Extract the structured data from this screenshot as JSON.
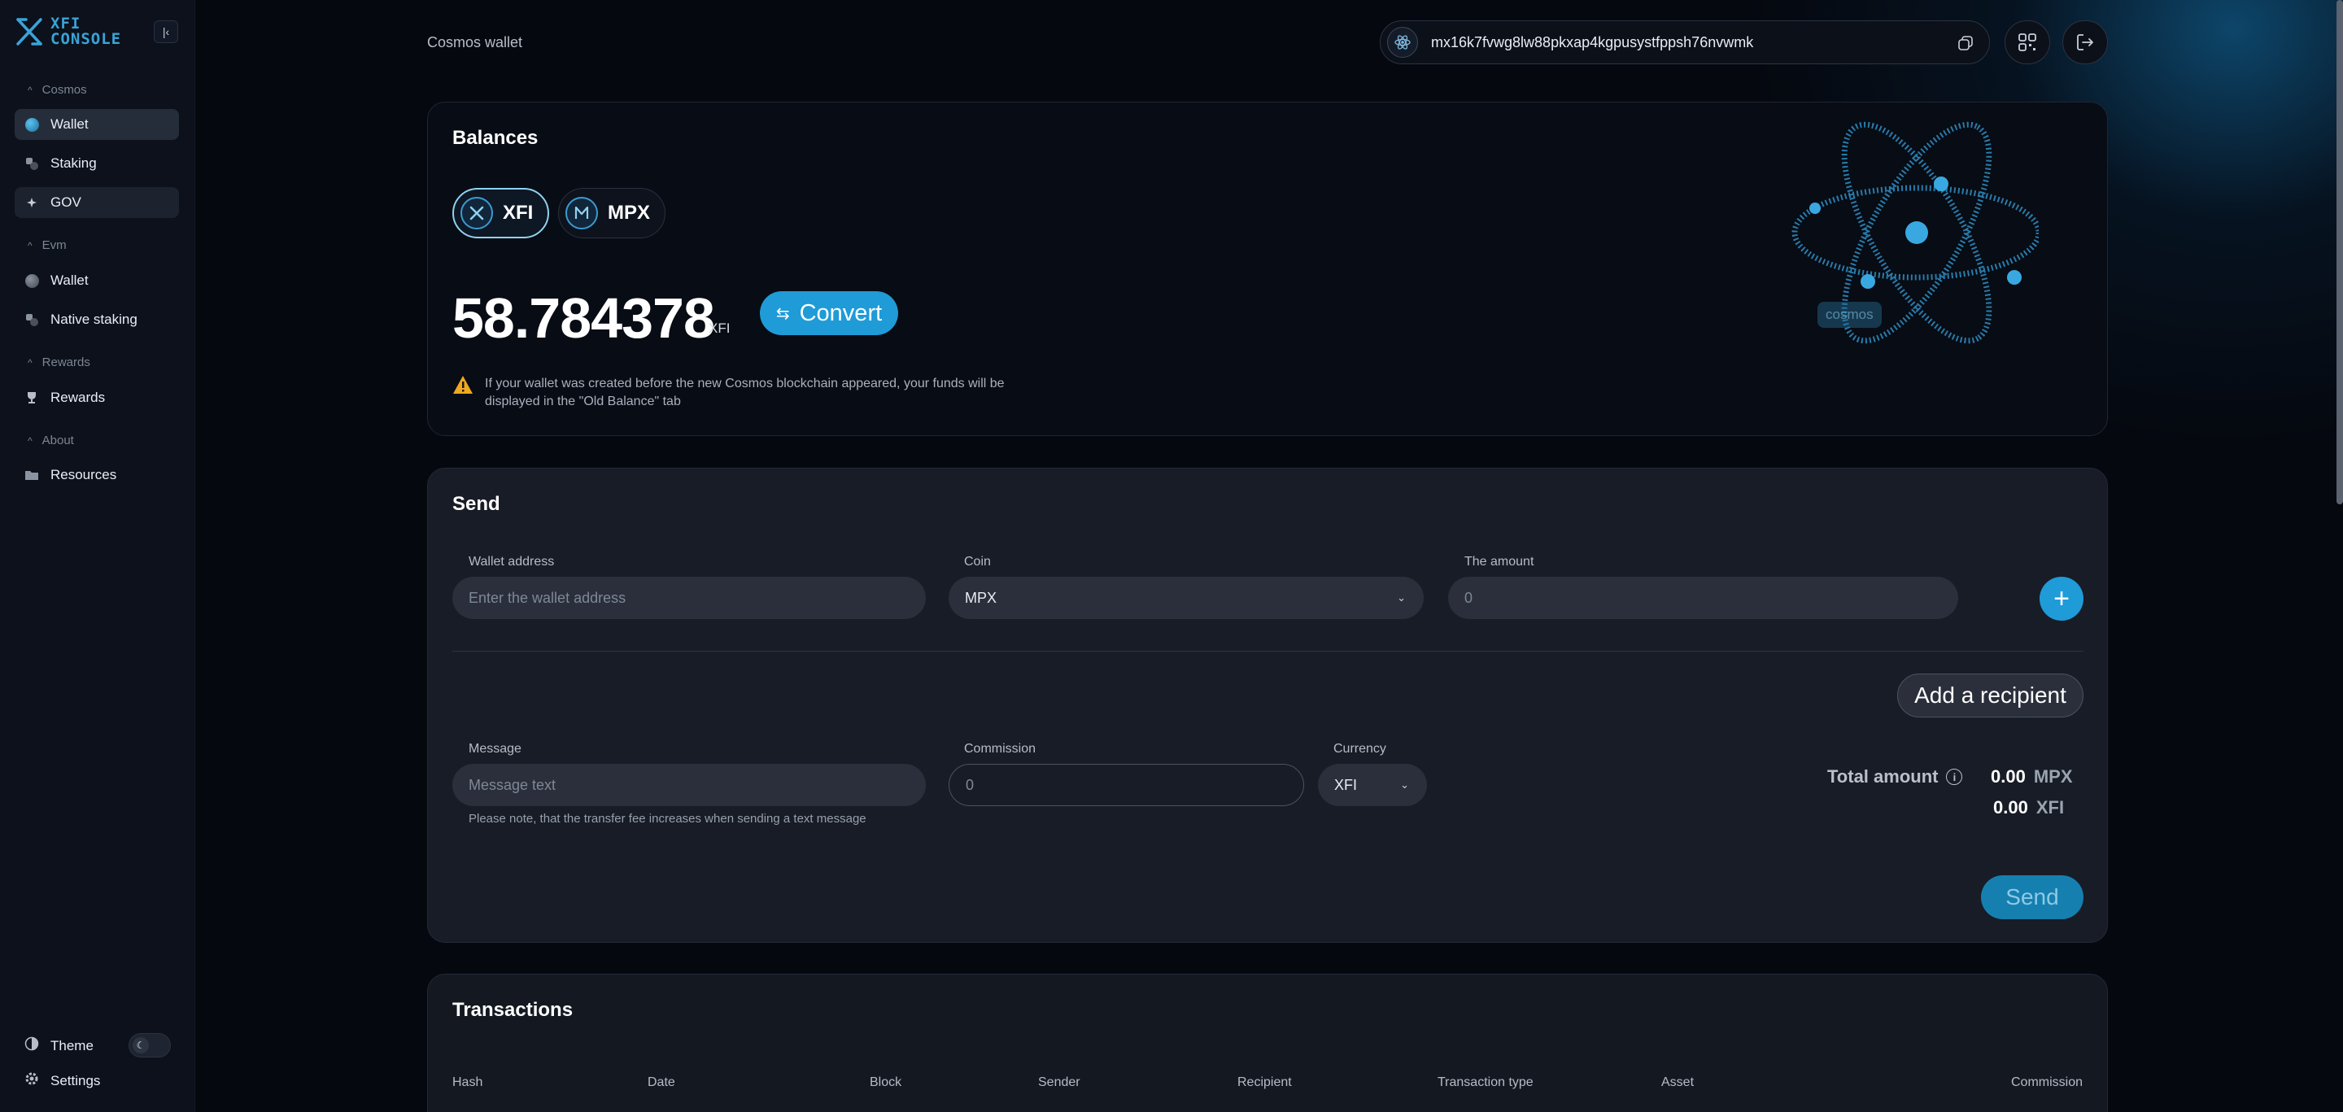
{
  "app": {
    "logo_line1": "XFI",
    "logo_line2": "CONSOLE",
    "accent_color": "#1f9bd8"
  },
  "sidebar": {
    "sections": [
      {
        "label": "Cosmos",
        "items": [
          {
            "label": "Wallet",
            "icon": "cosmos-wallet-icon",
            "active": true
          },
          {
            "label": "Staking",
            "icon": "staking-icon"
          },
          {
            "label": "GOV",
            "icon": "gov-icon"
          }
        ]
      },
      {
        "label": "Evm",
        "items": [
          {
            "label": "Wallet",
            "icon": "evm-wallet-icon"
          },
          {
            "label": "Native staking",
            "icon": "native-staking-icon"
          }
        ]
      },
      {
        "label": "Rewards",
        "items": [
          {
            "label": "Rewards",
            "icon": "trophy-icon"
          }
        ]
      },
      {
        "label": "About",
        "items": [
          {
            "label": "Resources",
            "icon": "folder-icon"
          }
        ]
      }
    ],
    "theme_label": "Theme",
    "settings_label": "Settings"
  },
  "header": {
    "page_title": "Cosmos wallet",
    "address": "mx16k7fvwg8lw88pkxap4kgpusystfppsh76nvwmk"
  },
  "balances": {
    "title": "Balances",
    "coins": [
      "XFI",
      "MPX"
    ],
    "selected_coin": "XFI",
    "amount": "58.784378",
    "unit": "XFI",
    "convert_label": "Convert",
    "warning": "If your wallet was created before the new Cosmos blockchain appeared, your funds will be displayed in the \"Old Balance\" tab",
    "artwork_label": "cosmos"
  },
  "send": {
    "title": "Send",
    "wallet_label": "Wallet address",
    "wallet_placeholder": "Enter the wallet address",
    "coin_label": "Coin",
    "coin_value": "MPX",
    "amount_label": "The amount",
    "amount_placeholder": "0",
    "add_recipient_label": "Add a recipient",
    "message_label": "Message",
    "message_placeholder": "Message text",
    "commission_label": "Commission",
    "commission_value": "0",
    "currency_label": "Currency",
    "currency_value": "XFI",
    "note": "Please note, that the transfer fee increases when sending a text message",
    "total_label": "Total amount",
    "totals": [
      {
        "value": "0.00",
        "unit": "MPX"
      },
      {
        "value": "0.00",
        "unit": "XFI"
      }
    ],
    "send_label": "Send"
  },
  "transactions": {
    "title": "Transactions",
    "columns": [
      "Hash",
      "Date",
      "Block",
      "Sender",
      "Recipient",
      "Transaction type",
      "Asset",
      "Commission"
    ]
  }
}
